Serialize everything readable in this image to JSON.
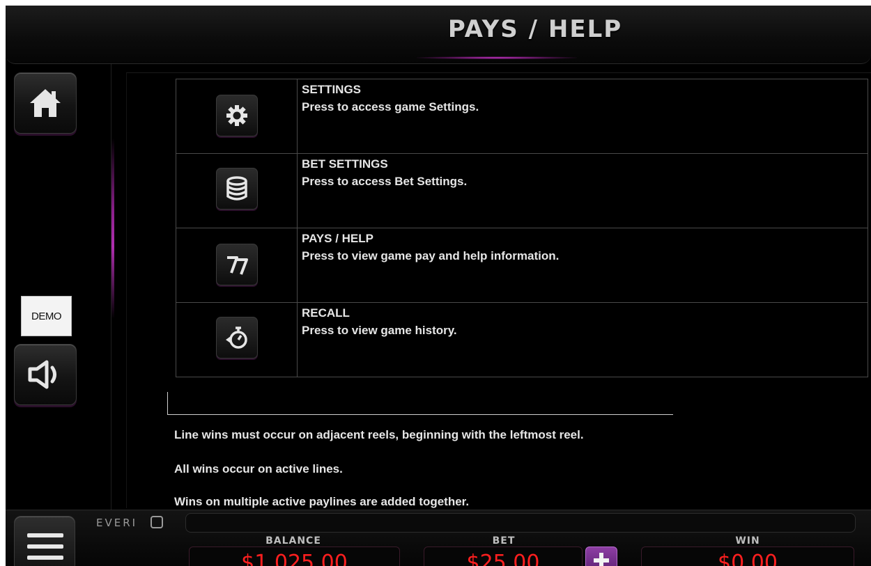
{
  "header": {
    "title": "PAYS / HELP"
  },
  "rail": {
    "demo_label": "DEMO"
  },
  "help_items": [
    {
      "icon": "gear-icon",
      "title": "SETTINGS",
      "description": "Press to access game Settings."
    },
    {
      "icon": "coin-stack-icon",
      "title": "BET SETTINGS",
      "description": "Press to access Bet Settings."
    },
    {
      "icon": "sevens-icon",
      "title": "PAYS / HELP",
      "description": "Press to view game pay and help information."
    },
    {
      "icon": "stopwatch-rewind-icon",
      "title": "RECALL",
      "description": "Press to view game history."
    }
  ],
  "rules": [
    "Line wins must occur on adjacent reels, beginning with the leftmost reel.",
    "All wins occur on active lines.",
    "Wins on multiple active paylines are added together."
  ],
  "bottom": {
    "logo_text": "EVERI",
    "balance_label": "BALANCE",
    "balance_value": "$1,025.00",
    "bet_label": "BET",
    "bet_value": "$25.00",
    "win_label": "WIN",
    "win_value": "$0.00"
  },
  "colors": {
    "accent": "#b02eb0",
    "meter_value": "#ff1f1f",
    "plus_button": "#7a2f92"
  }
}
